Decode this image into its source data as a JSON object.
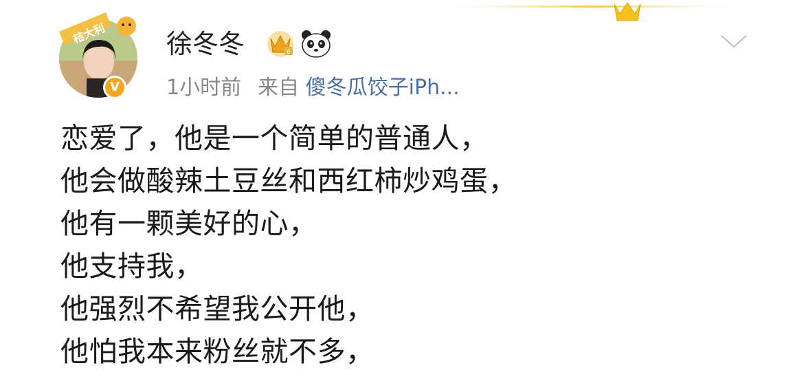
{
  "user": {
    "name": "徐冬冬",
    "avatar_sticker_text": "桔大利",
    "verified_badge": "V"
  },
  "meta": {
    "time": "1小时前",
    "source_prefix": "来自",
    "source_name": "傻冬瓜饺子iPh..."
  },
  "post": {
    "lines": [
      "恋爱了，他是一个简单的普通人，",
      "他会做酸辣土豆丝和西红柿炒鸡蛋，",
      "他有一颗美好的心，",
      "他支持我，",
      "他强烈不希望我公开他，",
      "他怕我本来粉丝就不多，"
    ]
  },
  "icons": {
    "vip": "crown-icon",
    "emoji": "panda-icon",
    "more": "chevron-down-icon",
    "decor": "gold-crown-decor-icon"
  },
  "colors": {
    "gold": "#f5b921",
    "link": "#4a6fa5",
    "meta": "#888888",
    "text": "#1a1a1a"
  }
}
